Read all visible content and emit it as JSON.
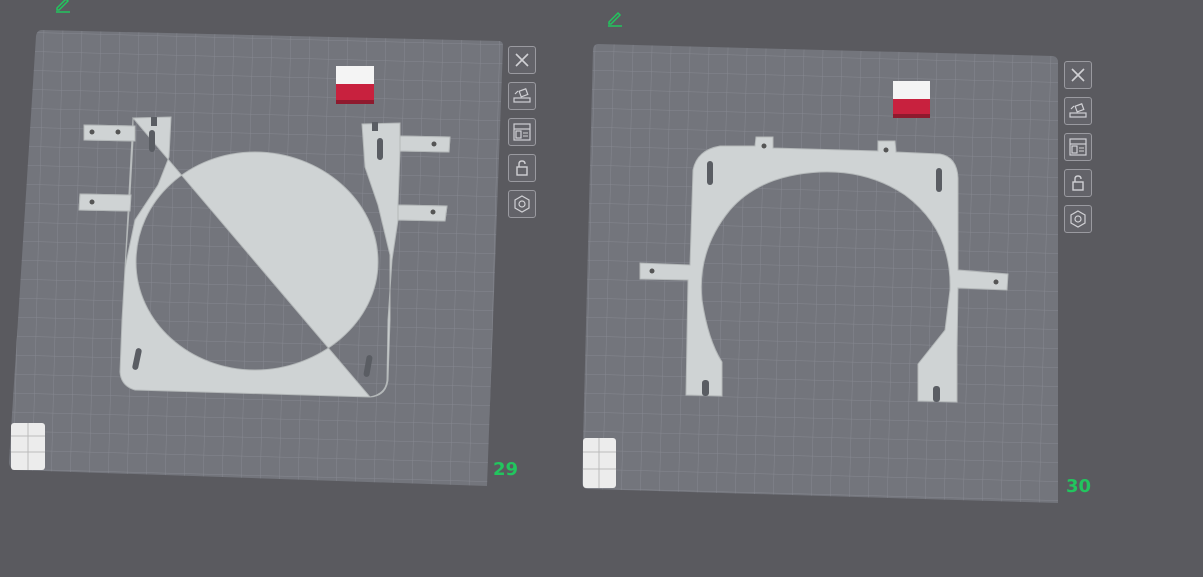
{
  "plates": [
    {
      "number": "29",
      "toolbar": [
        "close-icon",
        "auto-orient-icon",
        "arrange-icon",
        "lock-icon",
        "settings-icon"
      ]
    },
    {
      "number": "30",
      "toolbar": [
        "close-icon",
        "auto-orient-icon",
        "arrange-icon",
        "lock-icon",
        "settings-icon"
      ]
    }
  ],
  "colors": {
    "background": "#5a5a5f",
    "plate": "#72747b",
    "grid": "#8a8c92",
    "part": "#cfd3d4",
    "plate_number": "#22c55e",
    "filament_red": "#c8213e",
    "filament_white": "#f4f4f4"
  }
}
